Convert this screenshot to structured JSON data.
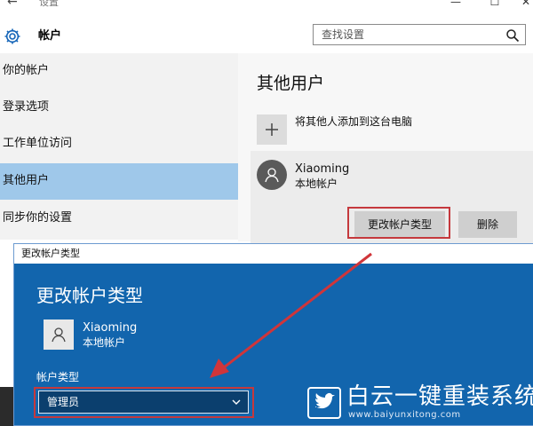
{
  "window": {
    "title": "设置",
    "back_glyph": "←",
    "minimize_glyph": "—",
    "maximize_glyph": "☐",
    "close_glyph": "✕"
  },
  "header": {
    "icon": "gear-icon",
    "title": "帐户",
    "search_placeholder": "查找设置",
    "search_icon": "search-icon"
  },
  "sidebar": {
    "items": [
      {
        "label": "你的帐户",
        "selected": false
      },
      {
        "label": "登录选项",
        "selected": false
      },
      {
        "label": "工作单位访问",
        "selected": false
      },
      {
        "label": "其他用户",
        "selected": true
      },
      {
        "label": "同步你的设置",
        "selected": false
      }
    ]
  },
  "main": {
    "title": "其他用户",
    "add_user_label": "将其他人添加到这台电脑",
    "add_user_glyph": "+",
    "user": {
      "name": "Xiaoming",
      "type": "本地帐户"
    },
    "change_type_button": "更改帐户类型",
    "delete_button": "删除"
  },
  "dialog": {
    "titlebar": "更改帐户类型",
    "heading": "更改帐户类型",
    "user": {
      "name": "Xiaoming",
      "type": "本地帐户"
    },
    "account_type_label": "帐户类型",
    "account_type_value": "管理员"
  },
  "watermark": {
    "title": "白云一键重装系统",
    "url": "www.baiyunxitong.com"
  },
  "colors": {
    "selected_sidebar": "#9fc8ea",
    "dialog_blue": "#1265ad",
    "highlight_red": "#c5393d",
    "button_gray": "#cfcfcf"
  }
}
